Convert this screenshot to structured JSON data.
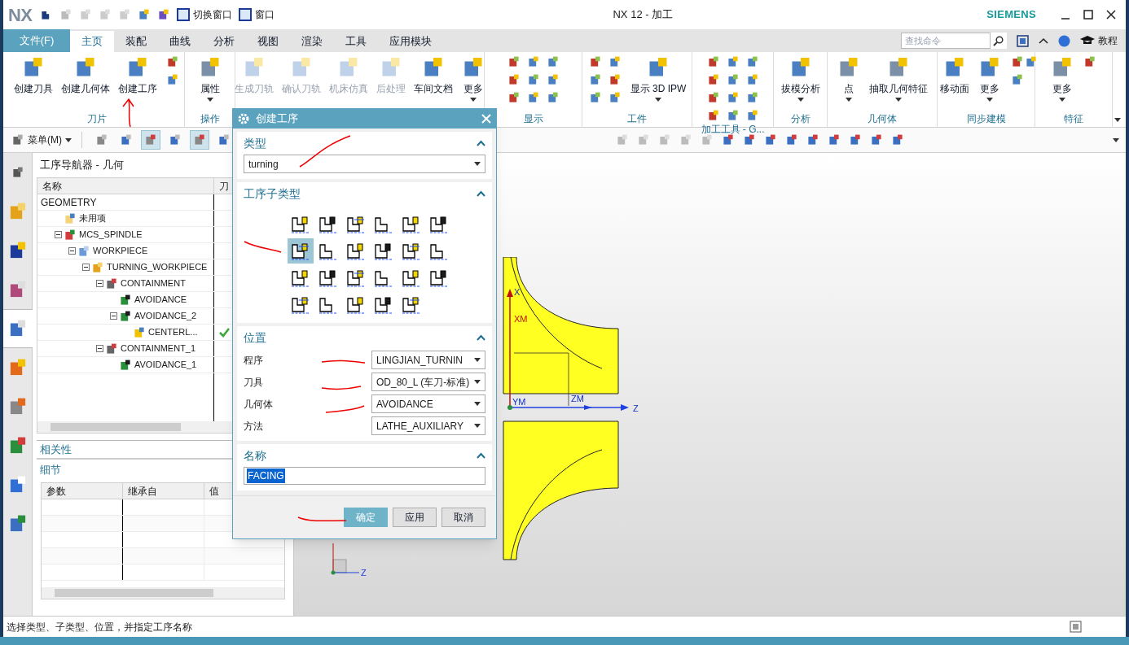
{
  "window": {
    "logo": "NX",
    "title": "NX 12 - 加工",
    "brand": "SIEMENS",
    "quick_access": [
      "切换窗口",
      "窗口"
    ]
  },
  "file_tab": "文件(F)",
  "tabs": [
    {
      "label": "主页",
      "selected": true
    },
    {
      "label": "装配",
      "selected": false
    },
    {
      "label": "曲线",
      "selected": false
    },
    {
      "label": "分析",
      "selected": false
    },
    {
      "label": "视图",
      "selected": false
    },
    {
      "label": "渲染",
      "selected": false
    },
    {
      "label": "工具",
      "selected": false
    },
    {
      "label": "应用模块",
      "selected": false
    }
  ],
  "search": {
    "placeholder": "查找命令"
  },
  "tutorial": "教程",
  "ribbon_groups": [
    {
      "kind": "create",
      "label": "刀片",
      "buttons": [
        {
          "label": "创建刀具",
          "disabled": false,
          "menu": false
        },
        {
          "label": "创建几何体",
          "disabled": false,
          "menu": false
        },
        {
          "label": "创建工序",
          "disabled": false,
          "menu": false
        }
      ]
    },
    {
      "kind": "operate",
      "label": "操作",
      "buttons": [
        {
          "label": "属性",
          "disabled": false,
          "menu": true
        }
      ]
    },
    {
      "kind": "toolpath",
      "buttons": [
        {
          "label": "生成刀轨",
          "disabled": true,
          "menu": false
        },
        {
          "label": "确认刀轨",
          "disabled": true,
          "menu": false
        },
        {
          "label": "机床仿真",
          "disabled": true,
          "menu": false
        },
        {
          "label": "后处理",
          "disabled": true,
          "menu": false
        },
        {
          "label": "车间文档",
          "disabled": false,
          "menu": false
        },
        {
          "label": "更多",
          "disabled": false,
          "menu": true
        }
      ]
    },
    {
      "kind": "display",
      "label": "显示"
    },
    {
      "kind": "workpiece",
      "label": "工件",
      "buttons": [
        {
          "label": "显示 3D IPW",
          "disabled": false,
          "menu": true
        }
      ]
    },
    {
      "kind": "tools",
      "label": "加工工具 - G..."
    },
    {
      "kind": "analysis",
      "label": "分析",
      "buttons": [
        {
          "label": "拔模分析",
          "disabled": false,
          "menu": true
        }
      ]
    },
    {
      "kind": "geometry",
      "label": "几何体",
      "buttons": [
        {
          "label": "点",
          "disabled": false,
          "menu": true
        },
        {
          "label": "抽取几何特征",
          "disabled": false,
          "menu": true
        }
      ]
    },
    {
      "kind": "sync",
      "label": "同步建模",
      "buttons": [
        {
          "label": "移动面",
          "disabled": false,
          "menu": false
        },
        {
          "label": "更多",
          "disabled": false,
          "menu": true
        }
      ]
    },
    {
      "kind": "feature",
      "label": "特征",
      "buttons": [
        {
          "label": "更多",
          "disabled": false,
          "menu": true
        }
      ]
    }
  ],
  "toolbar": {
    "menu": "菜单(M)",
    "tools": [
      {
        "selected": false
      },
      {
        "selected": false
      },
      {
        "selected": true
      },
      {
        "selected": false
      },
      {
        "selected": true
      },
      {
        "selected": false
      }
    ]
  },
  "rail": [
    {
      "selected": false
    },
    {
      "selected": false
    },
    {
      "selected": false
    },
    {
      "selected": false
    },
    {
      "selected": true
    },
    {
      "selected": false
    },
    {
      "selected": false
    },
    {
      "selected": false
    },
    {
      "selected": false
    },
    {
      "selected": false
    }
  ],
  "navigator": {
    "title": "工序导航器 - 几何",
    "columns": [
      "名称",
      "刀"
    ],
    "root": "GEOMETRY",
    "tree": [
      {
        "kind": "folder",
        "name": "未用项"
      },
      {
        "kind": "mcs",
        "name": "MCS_SPINDLE",
        "expanded": true,
        "children": [
          {
            "kind": "workpiece",
            "name": "WORKPIECE",
            "expanded": true,
            "children": [
              {
                "kind": "turning",
                "name": "TURNING_WORKPIECE",
                "expanded": true,
                "children": [
                  {
                    "kind": "containment",
                    "name": "CONTAINMENT",
                    "expanded": true,
                    "children": [
                      {
                        "kind": "avoidance",
                        "name": "AVOIDANCE"
                      },
                      {
                        "kind": "avoidance",
                        "name": "AVOIDANCE_2",
                        "expanded": true,
                        "children": [
                          {
                            "kind": "operation",
                            "name": "CENTERL...",
                            "complete": true
                          }
                        ]
                      }
                    ]
                  },
                  {
                    "kind": "containment",
                    "name": "CONTAINMENT_1",
                    "expanded": true,
                    "children": [
                      {
                        "kind": "avoidance",
                        "name": "AVOIDANCE_1"
                      }
                    ]
                  }
                ]
              }
            ]
          }
        ]
      }
    ]
  },
  "dependencies": "相关性",
  "details": {
    "title": "细节",
    "columns": [
      "参数",
      "继承自",
      "值"
    ]
  },
  "dialog": {
    "title": "创建工序",
    "type_section": {
      "label": "类型",
      "expanded": true,
      "value": "turning"
    },
    "subtype_section": {
      "label": "工序子类型",
      "expanded": true,
      "subtypes": [
        {
          "selected": false
        },
        {
          "selected": false
        },
        {
          "selected": false
        },
        {
          "selected": false
        },
        {
          "selected": false
        },
        {
          "selected": false
        },
        {
          "selected": true
        },
        {
          "selected": false
        },
        {
          "selected": false
        },
        {
          "selected": false
        },
        {
          "selected": false
        },
        {
          "selected": false
        },
        {
          "selected": false
        },
        {
          "selected": false
        },
        {
          "selected": false
        },
        {
          "selected": false
        },
        {
          "selected": false
        },
        {
          "selected": false
        },
        {
          "selected": false
        },
        {
          "selected": false
        },
        {
          "selected": false
        },
        {
          "selected": false
        },
        {
          "selected": false
        }
      ]
    },
    "location_section": {
      "label": "位置",
      "expanded": true,
      "fields": [
        {
          "label": "程序",
          "value": "LINGJIAN_TURNIN"
        },
        {
          "label": "刀具",
          "value": "OD_80_L (车刀-标准)"
        },
        {
          "label": "几何体",
          "value": "AVOIDANCE"
        },
        {
          "label": "方法",
          "value": "LATHE_AUXILIARY"
        }
      ]
    },
    "name_section": {
      "label": "名称",
      "expanded": true,
      "value": "FACING"
    },
    "buttons": [
      {
        "label": "确定",
        "primary": true
      },
      {
        "label": "应用",
        "primary": false
      },
      {
        "label": "取消",
        "primary": false
      }
    ]
  },
  "viewport": {
    "labels": [
      "X",
      "XM",
      "YM",
      "ZM",
      "Z"
    ],
    "triad_label": "Z"
  },
  "status_bar": "选择类型、子类型、位置，并指定工序名称"
}
